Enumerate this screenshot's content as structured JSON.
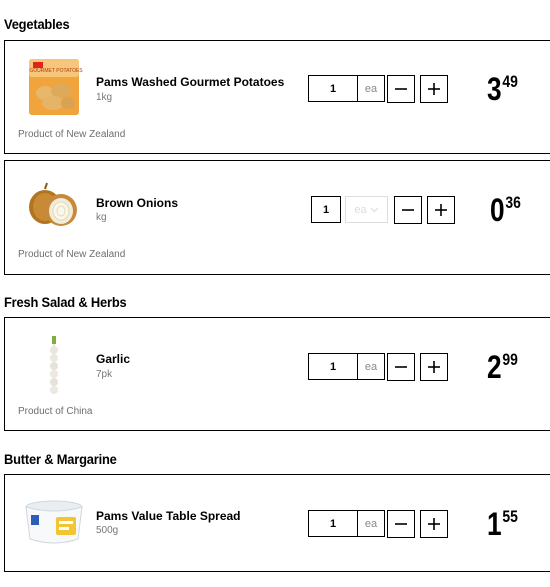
{
  "sections": [
    {
      "title": "Vegetables",
      "items": [
        {
          "name": "Pams Washed Gourmet Potatoes",
          "size": "1kg",
          "origin": "Product of New Zealand",
          "qty": "1",
          "unit": "ea",
          "dollars": "3",
          "cents": "49"
        },
        {
          "name": "Brown Onions",
          "size": "kg",
          "origin": "Product of New Zealand",
          "qty": "1",
          "unit": "ea",
          "dollars": "0",
          "cents": "36"
        }
      ]
    },
    {
      "title": "Fresh Salad & Herbs",
      "items": [
        {
          "name": "Garlic",
          "size": "7pk",
          "origin": "Product of China",
          "qty": "1",
          "unit": "ea",
          "dollars": "2",
          "cents": "99"
        }
      ]
    },
    {
      "title": "Butter & Margarine",
      "items": [
        {
          "name": "Pams Value Table Spread",
          "size": "500g",
          "qty": "1",
          "unit": "ea",
          "dollars": "1",
          "cents": "55"
        }
      ]
    }
  ],
  "potato_bag_text": "GOURMET POTATOES",
  "icons": {
    "minus": "minus-icon",
    "plus": "plus-icon",
    "dropdown": "chevron-down-icon"
  }
}
